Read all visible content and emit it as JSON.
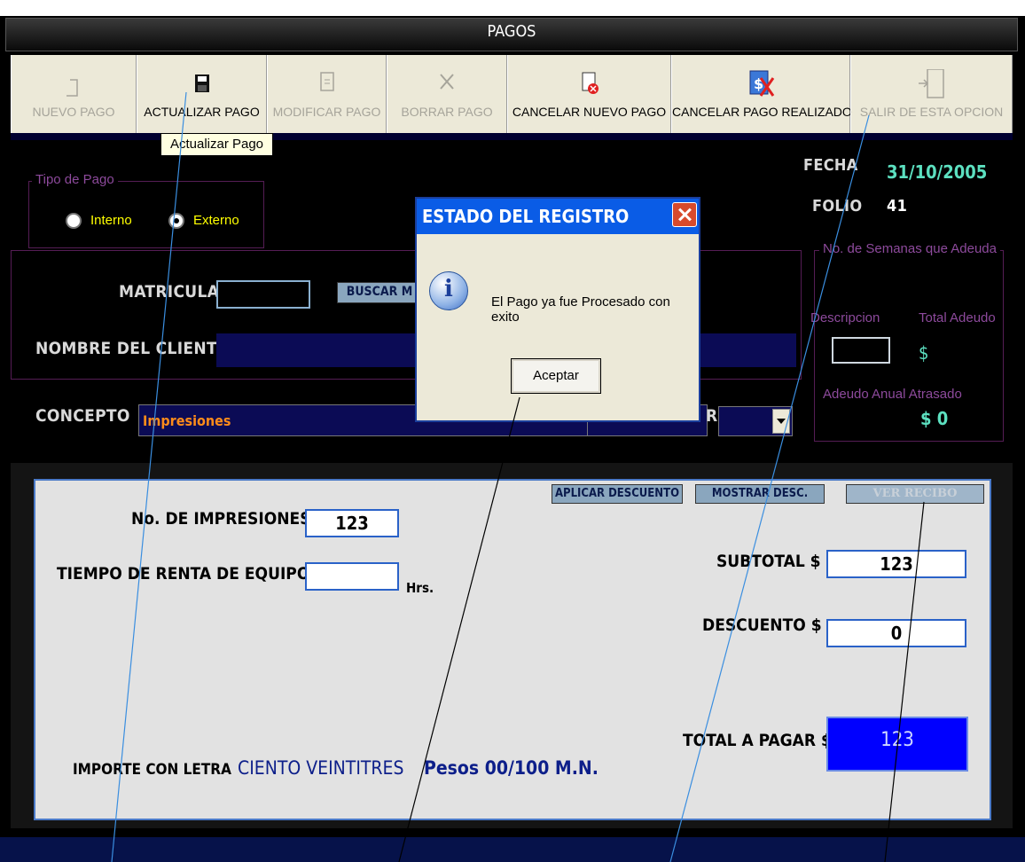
{
  "window": {
    "title": "PAGOS"
  },
  "toolbar": {
    "buttons": [
      {
        "label": "NUEVO PAGO",
        "icon": "new-page-icon",
        "enabled": false
      },
      {
        "label": "ACTUALIZAR PAGO",
        "icon": "floppy-disk-icon",
        "enabled": true
      },
      {
        "label": "MODIFICAR PAGO",
        "icon": "edit-document-icon",
        "enabled": false
      },
      {
        "label": "BORRAR PAGO",
        "icon": "delete-x-icon",
        "enabled": false
      },
      {
        "label": "CANCELAR NUEVO PAGO",
        "icon": "cancel-document-icon",
        "enabled": true
      },
      {
        "label": "CANCELAR PAGO REALIZADO",
        "icon": "cancel-money-icon",
        "enabled": true
      },
      {
        "label": "SALIR DE ESTA OPCION",
        "icon": "exit-door-icon",
        "enabled": false
      }
    ],
    "tooltip": "Actualizar Pago"
  },
  "tipo_pago": {
    "group_label": "Tipo de Pago",
    "options": [
      "Interno",
      "Externo"
    ],
    "selected": "Externo"
  },
  "header_info": {
    "fecha_label": "FECHA",
    "fecha_value": "31/10/2005",
    "folio_label": "FOLIO",
    "folio_value": "41"
  },
  "semanas": {
    "group_label": "No. de Semanas que Adeuda",
    "descripcion_label": "Descripcion",
    "total_adeudo_label": "Total Adeudo",
    "total_adeudo_value": "$",
    "anual_label": "Adeudo Anual Atrasado",
    "anual_value": "$ 0"
  },
  "cliente": {
    "matricula_label": "MATRICULA",
    "matricula_value": "",
    "buscar_label": "BUSCAR M",
    "nombre_label": "NOMBRE DEL CLIENTE",
    "nombre_value": ""
  },
  "concepto": {
    "label": "CONCEPTO",
    "value": "Impresiones",
    "partial_label": "R"
  },
  "detalle": {
    "aplicar_descuento": "APLICAR DESCUENTO",
    "mostrar_desc": "MOSTRAR DESC.",
    "ver_recibo": "VER RECIBO",
    "impresiones_label": "No. DE IMPRESIONES",
    "impresiones_value": "123",
    "tiempo_label": "TIEMPO DE RENTA DE EQUIPO",
    "tiempo_value": "",
    "hrs_label": "Hrs.",
    "subtotal_label": "SUBTOTAL $",
    "subtotal_value": "123",
    "descuento_label": "DESCUENTO $",
    "descuento_value": "0",
    "total_label": "TOTAL A PAGAR $",
    "total_value": "123",
    "importe_label": "IMPORTE CON LETRA",
    "importe_words": "CIENTO VEINTITRES",
    "importe_suffix": "Pesos 00/100 M.N."
  },
  "dialog": {
    "title": "ESTADO DEL REGISTRO",
    "message": "El Pago ya fue Procesado con exito",
    "ok_label": "Aceptar",
    "icon": "info-icon"
  },
  "colors": {
    "navy": "#0b0b55",
    "accent_blue": "#0000ff",
    "teal": "#5ce0c0",
    "yellow": "#ffff00"
  }
}
